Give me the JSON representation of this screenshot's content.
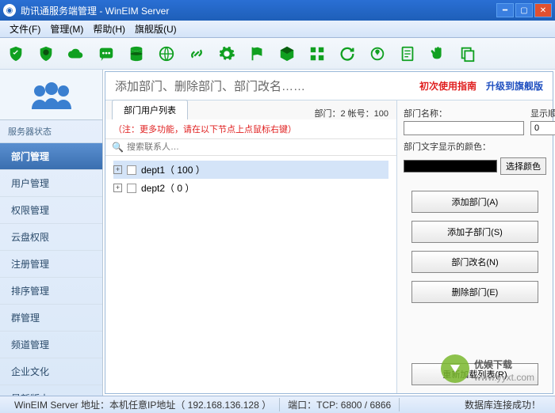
{
  "window": {
    "title": "助讯通服务端管理 - WinEIM Server"
  },
  "menu": {
    "file": "文件(F)",
    "manage": "管理(M)",
    "help": "帮助(H)",
    "flagship": "旗舰版(U)"
  },
  "sidebar": {
    "title": "服务器状态",
    "items": [
      {
        "label": "部门管理",
        "active": true
      },
      {
        "label": "用户管理"
      },
      {
        "label": "权限管理"
      },
      {
        "label": "云盘权限"
      },
      {
        "label": "注册管理"
      },
      {
        "label": "排序管理"
      },
      {
        "label": "群管理"
      },
      {
        "label": "频道管理"
      },
      {
        "label": "企业文化"
      },
      {
        "label": "最新版本"
      }
    ]
  },
  "main": {
    "desc": "添加部门、删除部门、部门改名……",
    "guide_link": "初次使用指南",
    "upgrade_link": "升级到旗舰版",
    "tab": "部门用户列表",
    "counts": "部门：2  帐号：100",
    "hint": "（注：更多功能，请在以下节点上点鼠标右键）",
    "search_placeholder": "搜索联系人…",
    "tree": [
      {
        "label": "dept1（ 100 ）",
        "expanded": false,
        "selected": true
      },
      {
        "label": "dept2（ 0 ）",
        "expanded": false,
        "selected": false
      }
    ]
  },
  "form": {
    "name_label": "部门名称：",
    "name_value": "",
    "order_label": "显示顺序：",
    "order_value": "0",
    "color_label": "部门文字显示的颜色：",
    "color_btn": "选择颜色",
    "btn_add": "添加部门(A)",
    "btn_add_sub": "添加子部门(S)",
    "btn_rename": "部门改名(N)",
    "btn_delete": "删除部门(E)",
    "btn_reload": "重新加载列表(R)"
  },
  "status": {
    "addr_label": "WinEIM Server 地址：本机任意IP地址（ 192.168.136.128 ）",
    "port": "端口：TCP: 6800 / 6866",
    "db": "数据库连接成功！"
  },
  "watermark": "优娱下载 www.yyxt.com"
}
